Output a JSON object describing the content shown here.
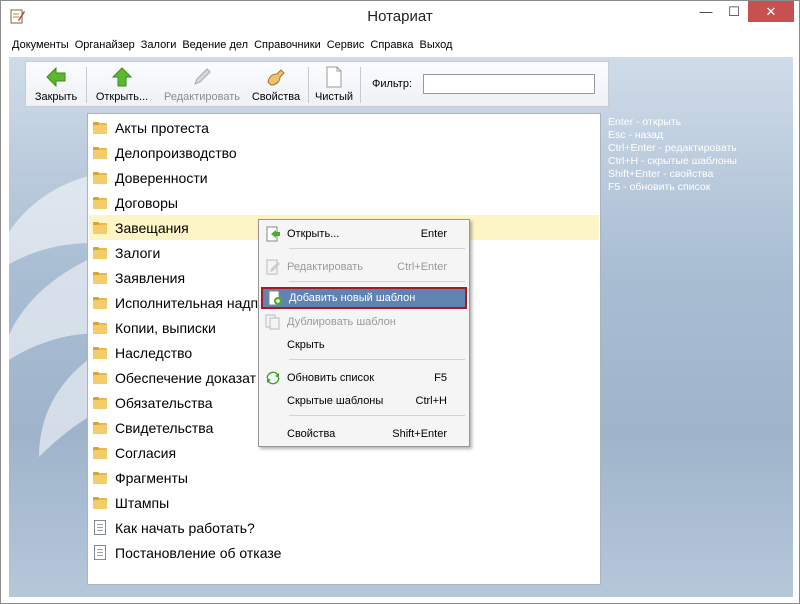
{
  "window": {
    "title": "Нотариат",
    "minimize": "—",
    "maximize": "☐",
    "close": "✕"
  },
  "menubar": [
    "Документы",
    "Органайзер",
    "Залоги",
    "Ведение дел",
    "Справочники",
    "Сервис",
    "Справка",
    "Выход"
  ],
  "toolbar": {
    "close_label": "Закрыть",
    "open_label": "Открыть...",
    "edit_label": "Редактировать",
    "properties_label": "Свойства",
    "clean_label": "Чистый",
    "filter_label": "Фильтр:",
    "filter_value": ""
  },
  "list": [
    {
      "label": "Акты протеста",
      "type": "folder"
    },
    {
      "label": "Делопроизводство",
      "type": "folder"
    },
    {
      "label": "Доверенности",
      "type": "folder"
    },
    {
      "label": "Договоры",
      "type": "folder"
    },
    {
      "label": "Завещания",
      "type": "folder",
      "selected": true
    },
    {
      "label": "Залоги",
      "type": "folder"
    },
    {
      "label": "Заявления",
      "type": "folder"
    },
    {
      "label": "Исполнительная надп",
      "type": "folder"
    },
    {
      "label": "Копии, выписки",
      "type": "folder"
    },
    {
      "label": "Наследство",
      "type": "folder"
    },
    {
      "label": "Обеспечение доказат",
      "type": "folder"
    },
    {
      "label": "Обязательства",
      "type": "folder"
    },
    {
      "label": "Свидетельства",
      "type": "folder"
    },
    {
      "label": "Согласия",
      "type": "folder"
    },
    {
      "label": "Фрагменты",
      "type": "folder"
    },
    {
      "label": "Штампы",
      "type": "folder"
    },
    {
      "label": "Как начать работать?",
      "type": "document"
    },
    {
      "label": "Постановление об отказе",
      "type": "document"
    }
  ],
  "shortcuts": [
    "Enter - открыть",
    "Esc - назад",
    "Ctrl+Enter - редактировать",
    "Ctrl+H - скрытые шаблоны",
    "Shift+Enter - свойства",
    "F5 - обновить список"
  ],
  "context_menu": [
    {
      "label": "Открыть...",
      "key": "Enter"
    },
    {
      "label": "Редактировать",
      "key": "Ctrl+Enter",
      "disabled": true
    },
    {
      "label": "Добавить новый шаблон",
      "key": "",
      "highlight": true
    },
    {
      "label": "Дублировать шаблон",
      "key": "",
      "disabled": true
    },
    {
      "label": "Скрыть",
      "key": ""
    },
    {
      "label": "Обновить список",
      "key": "F5"
    },
    {
      "label": "Скрытые шаблоны",
      "key": "Ctrl+H"
    },
    {
      "label": "Свойства",
      "key": "Shift+Enter"
    }
  ],
  "colors": {
    "selection": "#fdf5c6",
    "menu_highlight": "#5f84b2",
    "highlight_border": "#a31b24",
    "background": "#a9bdd3"
  }
}
